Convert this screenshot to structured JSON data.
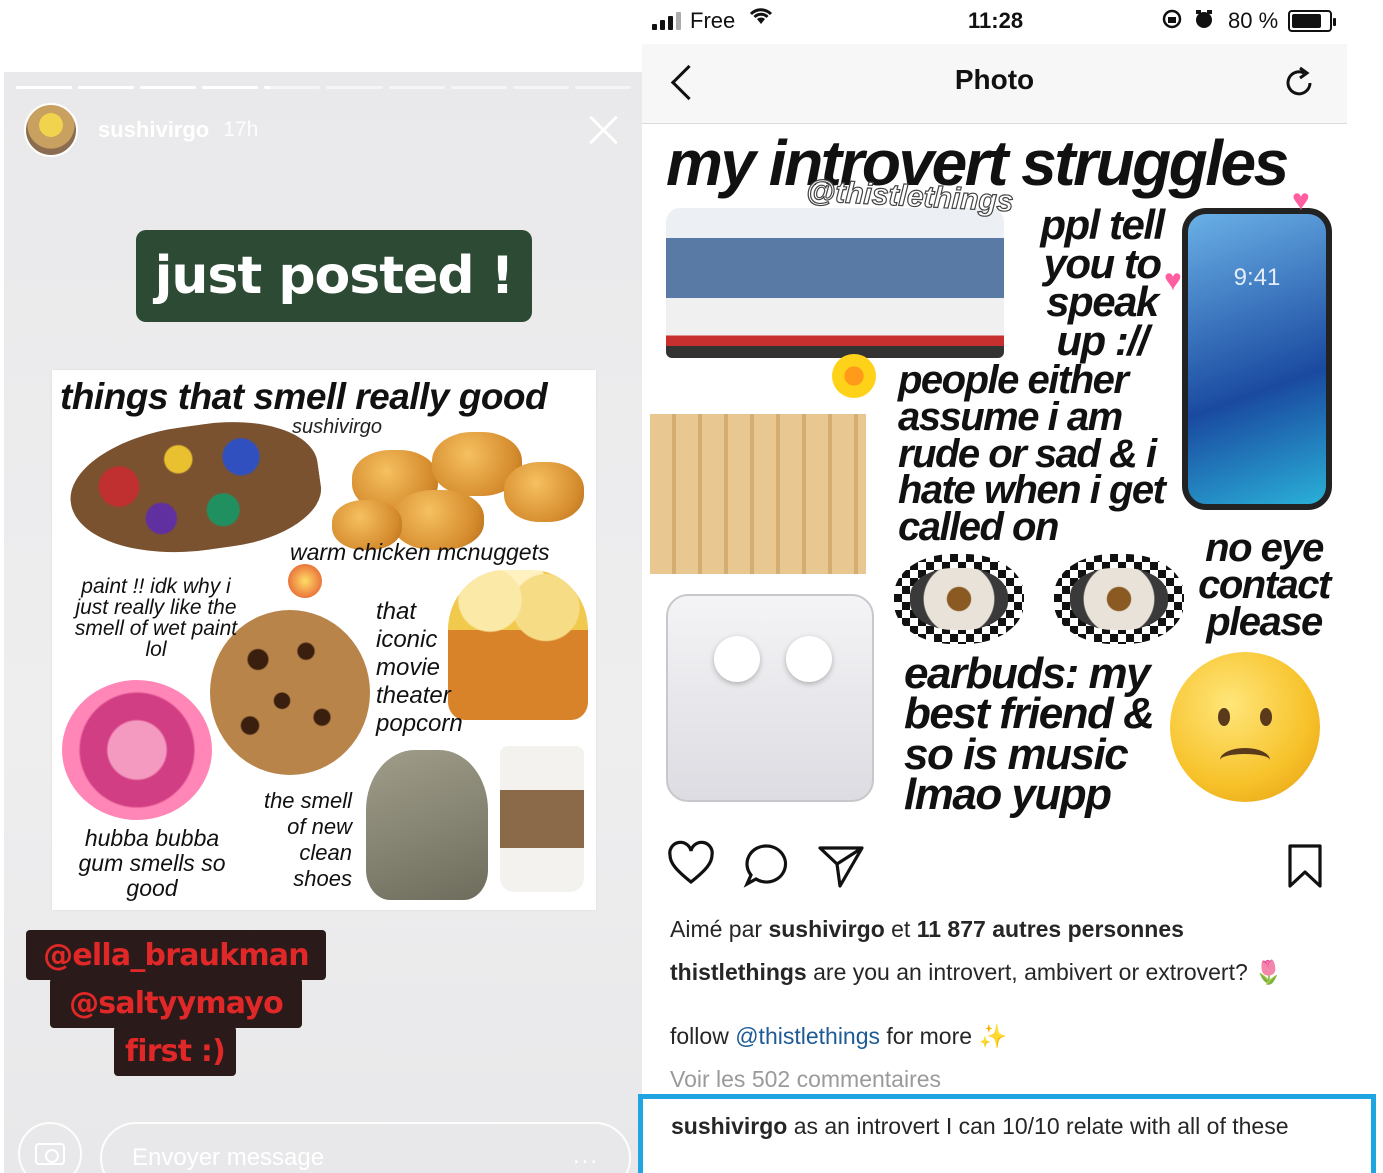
{
  "story": {
    "progress": [
      1,
      1,
      1,
      1,
      0.1,
      0,
      0,
      0,
      0,
      0
    ],
    "username": "sushivirgo",
    "time": "17h",
    "sticker": "just posted !",
    "collage": {
      "title": "things that smell really good",
      "author": "sushivirgo",
      "captions": {
        "nuggets": "warm chicken mcnuggets",
        "paint": "paint !! idk why i just really like the smell of wet paint lol",
        "popcorn": "that iconic movie theater popcorn",
        "gum": "hubba bubba gum smells so good",
        "shoes": "the smell of new clean shoes"
      }
    },
    "mentions": [
      "@ella_braukman",
      "@saltyymayo",
      "first :)"
    ],
    "message_placeholder": "Envoyer message",
    "more": "..."
  },
  "status": {
    "carrier": "Free",
    "time": "11:28",
    "battery": "80 %",
    "battery_level": 0.8
  },
  "nav": {
    "title": "Photo"
  },
  "post": {
    "image": {
      "title": "my introvert struggles",
      "handle": "@thistlethings",
      "text_speak": "ppl tell you to speak up ://",
      "text_assume": "people either assume i am rude or sad & i hate when i get called on",
      "text_eye": "no eye contact please",
      "text_earbuds": "earbuds: my best friend & so is music lmao yupp",
      "phone_time": "9:41"
    },
    "likes_prefix": "Aimé par",
    "likes_user": "sushivirgo",
    "likes_mid": "et",
    "likes_rest": "11 877 autres personnes",
    "caption_user": "thistlethings",
    "caption_text": "are you an introvert, ambivert or extrovert?",
    "caption_emoji": "🌷",
    "follow_prefix": "follow",
    "follow_handle": "@thistlethings",
    "follow_suffix": "for more",
    "follow_emoji": "✨",
    "view_comments": "Voir les 502 commentaires",
    "comment_user": "sushivirgo",
    "comment_text": "as an introvert I can 10/10 relate with all of these"
  }
}
